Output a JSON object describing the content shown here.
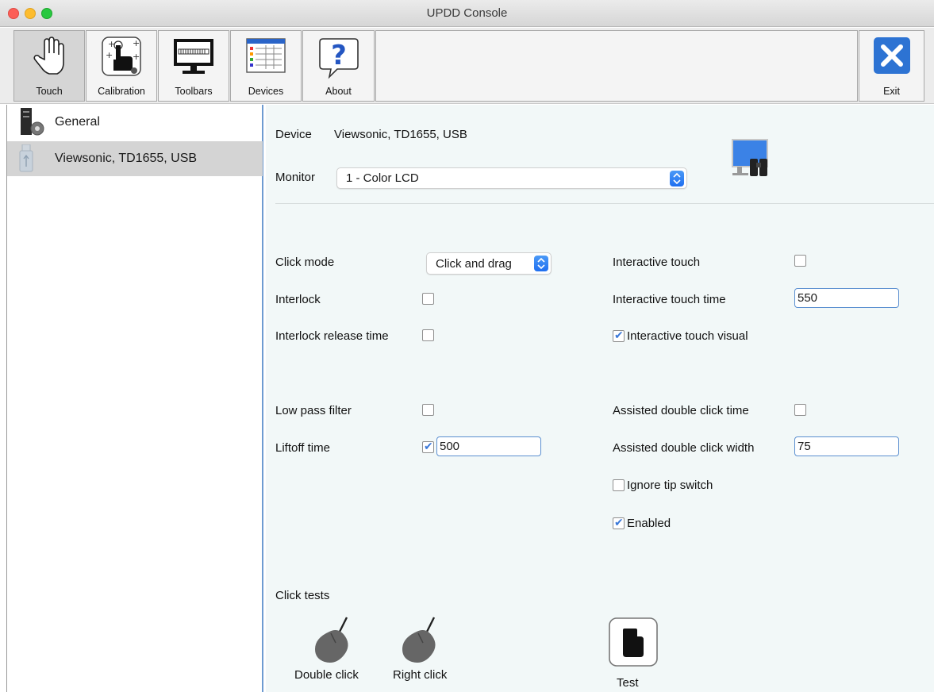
{
  "window": {
    "title": "UPDD Console"
  },
  "toolbar": {
    "touch_label": "Touch",
    "calibration_label": "Calibration",
    "toolbars_label": "Toolbars",
    "devices_label": "Devices",
    "about_label": "About",
    "exit_label": "Exit"
  },
  "sidebar": {
    "items": [
      {
        "label": "General"
      },
      {
        "label": "Viewsonic, TD1655, USB"
      }
    ]
  },
  "device": {
    "device_label": "Device",
    "device_value": "Viewsonic, TD1655, USB",
    "monitor_label": "Monitor",
    "monitor_value": "1 - Color LCD"
  },
  "settings": {
    "click_mode_label": "Click mode",
    "click_mode_value": "Click and drag",
    "interlock_label": "Interlock",
    "interlock_release_label": "Interlock release time",
    "interactive_touch_label": "Interactive touch",
    "interactive_touch_time_label": "Interactive touch time",
    "interactive_touch_time_value": "550",
    "interactive_touch_visual_label": "Interactive touch visual",
    "low_pass_label": "Low pass filter",
    "liftoff_label": "Liftoff time",
    "liftoff_value": "500",
    "assisted_dc_time_label": "Assisted double click time",
    "assisted_dc_width_label": "Assisted double click width",
    "assisted_dc_width_value": "75",
    "ignore_tip_label": "Ignore tip switch",
    "enabled_label": "Enabled"
  },
  "checks": {
    "interlock": false,
    "interlock_release": false,
    "interactive_touch": false,
    "interactive_touch_visual": true,
    "low_pass": false,
    "liftoff": true,
    "assisted_dc_time": false,
    "ignore_tip": false,
    "enabled": true
  },
  "click_tests": {
    "heading": "Click tests",
    "double_click_label": "Double click",
    "right_click_label": "Right click",
    "test_label": "Test"
  }
}
